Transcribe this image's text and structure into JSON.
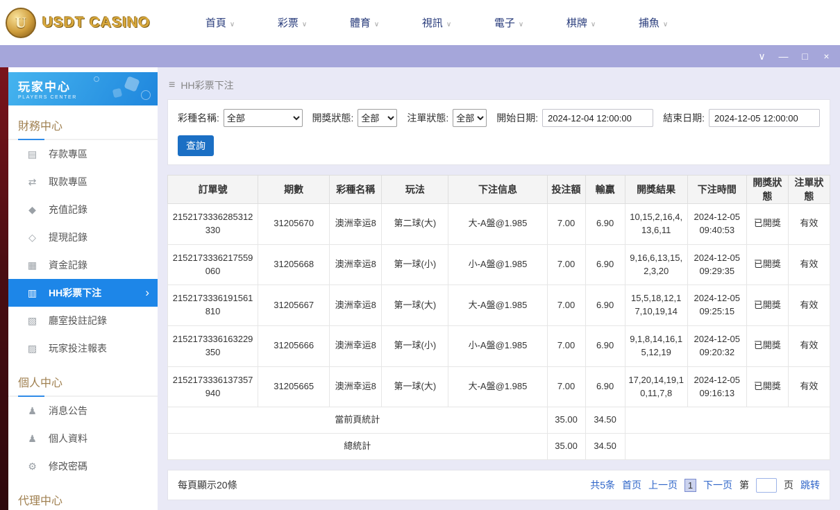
{
  "colors": {
    "accent_blue": "#1d86e8",
    "titlebar_lavender": "#a5a6da",
    "logo_gold": "#d9a93d",
    "link_blue": "#2d64c8",
    "backdrop_maroon": "#4a0d12"
  },
  "topnav": {
    "logo_initial": "U",
    "logo_text": "USDT CASINO",
    "chevron_glyph": "∨",
    "items": [
      "首頁",
      "彩票",
      "體育",
      "視訊",
      "電子",
      "棋牌",
      "捕魚"
    ]
  },
  "window_controls": {
    "collapse": "∨",
    "minimize": "—",
    "maximize": "□",
    "close": "×"
  },
  "sidebar": {
    "title": "玩家中心",
    "subtitle": "PLAYERS CENTER",
    "sections": [
      {
        "heading": "財務中心",
        "items": [
          {
            "label": "存款專區",
            "icon": "deposit-icon",
            "glyph": "▤"
          },
          {
            "label": "取款專區",
            "icon": "withdraw-icon",
            "glyph": "⇄"
          },
          {
            "label": "充值記錄",
            "icon": "recharge-record-icon",
            "glyph": "◆"
          },
          {
            "label": "提現記錄",
            "icon": "withdrawal-record-icon",
            "glyph": "◇"
          },
          {
            "label": "資金記錄",
            "icon": "funds-record-icon",
            "glyph": "▦"
          },
          {
            "label": "HH彩票下注",
            "icon": "lottery-bet-icon",
            "glyph": "▥",
            "active": true,
            "arrow": "›"
          },
          {
            "label": "廳室投註記錄",
            "icon": "room-bet-record-icon",
            "glyph": "▧"
          },
          {
            "label": "玩家投注報表",
            "icon": "player-bet-report-icon",
            "glyph": "▨"
          }
        ]
      },
      {
        "heading": "個人中心",
        "items": [
          {
            "label": "消息公告",
            "icon": "announcement-icon",
            "glyph": "♟"
          },
          {
            "label": "個人資料",
            "icon": "profile-icon",
            "glyph": "♟"
          },
          {
            "label": "修改密碼",
            "icon": "password-icon",
            "glyph": "⚙"
          }
        ]
      },
      {
        "heading": "代理中心",
        "items": []
      }
    ]
  },
  "breadcrumb": {
    "icon_glyph": "≡",
    "title": "HH彩票下注"
  },
  "filters": {
    "lottery_label": "彩種名稱:",
    "lottery_value": "全部",
    "draw_status_label": "開獎狀態:",
    "draw_status_value": "全部",
    "order_status_label": "注單狀態:",
    "order_status_value": "全部",
    "start_label": "開始日期:",
    "start_value": "2024-12-04 12:00:00",
    "end_label": "結束日期:",
    "end_value": "2024-12-05 12:00:00",
    "search_button": "查詢"
  },
  "table": {
    "headers": [
      "訂單號",
      "期數",
      "彩種名稱",
      "玩法",
      "下注信息",
      "投注額",
      "輸贏",
      "開獎結果",
      "下注時間",
      "開獎狀態",
      "注單狀態"
    ],
    "rows": [
      [
        "2152173336285312330",
        "31205670",
        "澳洲幸运8",
        "第二球(大)",
        "大-A盤@1.985",
        "7.00",
        "6.90",
        "10,15,2,16,4,13,6,11",
        "2024-12-05 09:40:53",
        "已開獎",
        "有效"
      ],
      [
        "2152173336217559060",
        "31205668",
        "澳洲幸运8",
        "第一球(小)",
        "小-A盤@1.985",
        "7.00",
        "6.90",
        "9,16,6,13,15,2,3,20",
        "2024-12-05 09:29:35",
        "已開獎",
        "有效"
      ],
      [
        "2152173336191561810",
        "31205667",
        "澳洲幸运8",
        "第一球(大)",
        "大-A盤@1.985",
        "7.00",
        "6.90",
        "15,5,18,12,17,10,19,14",
        "2024-12-05 09:25:15",
        "已開獎",
        "有效"
      ],
      [
        "2152173336163229350",
        "31205666",
        "澳洲幸运8",
        "第一球(小)",
        "小-A盤@1.985",
        "7.00",
        "6.90",
        "9,1,8,14,16,15,12,19",
        "2024-12-05 09:20:32",
        "已開獎",
        "有效"
      ],
      [
        "2152173336137357940",
        "31205665",
        "澳洲幸运8",
        "第一球(大)",
        "大-A盤@1.985",
        "7.00",
        "6.90",
        "17,20,14,19,10,11,7,8",
        "2024-12-05 09:16:13",
        "已開獎",
        "有效"
      ]
    ],
    "summary": {
      "page_label": "當前頁統計",
      "page_bet": "35.00",
      "page_win": "34.50",
      "total_label": "總統計",
      "total_bet": "35.00",
      "total_win": "34.50"
    }
  },
  "pagination": {
    "page_size_text": "每頁顯示20條",
    "total_text": "共5条",
    "first": "首页",
    "prev": "上一页",
    "current": "1",
    "next": "下一页",
    "jump_prefix": "第",
    "jump_suffix": "页",
    "jump_button": "跳转"
  }
}
